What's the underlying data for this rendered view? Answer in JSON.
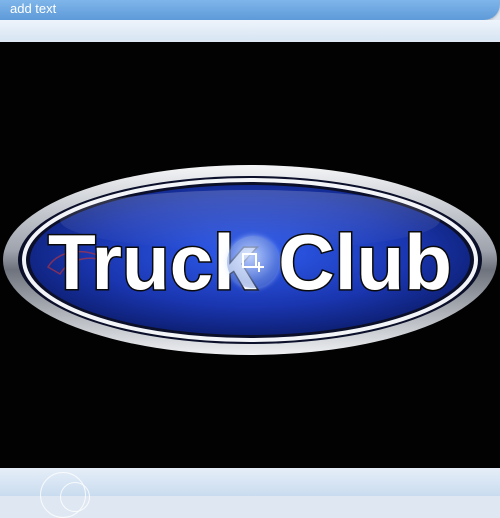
{
  "toolbar": {
    "add_text_label": "add text"
  },
  "image": {
    "logo_text": "Truck Club"
  },
  "overlay": {
    "icon": "select-region-icon"
  },
  "colors": {
    "toolbar": "#6aa6e0",
    "photo_background": "#020202",
    "badge_blue": "#1b3fb8",
    "badge_rim": "#c9ccd2"
  }
}
